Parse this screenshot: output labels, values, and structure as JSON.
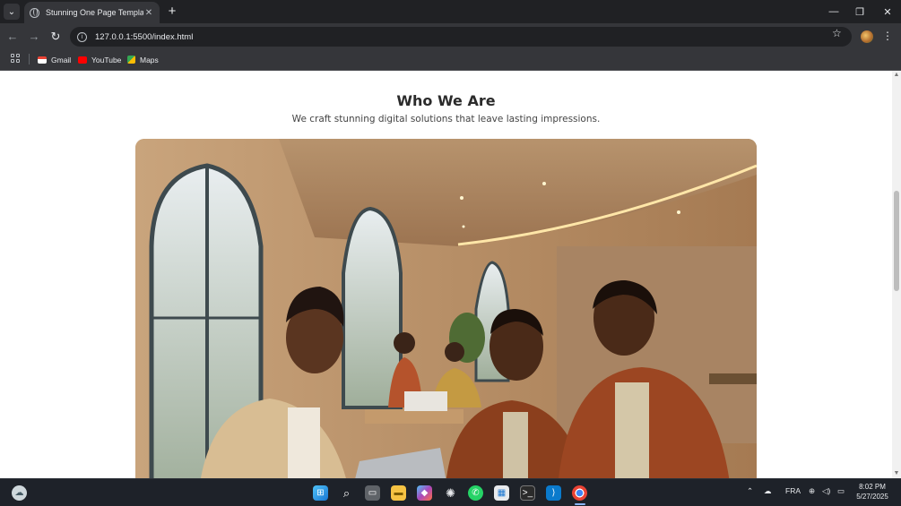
{
  "browser": {
    "tab_title": "Stunning One Page Template",
    "url": "127.0.0.1:5500/index.html",
    "bookmarks": [
      {
        "label": "Gmail",
        "icon": "gmail-icon",
        "color": "#ea4335"
      },
      {
        "label": "YouTube",
        "icon": "youtube-icon",
        "color": "#ff0000"
      },
      {
        "label": "Maps",
        "icon": "maps-icon",
        "color": "#34a853"
      }
    ]
  },
  "page": {
    "section_title": "Who We Are",
    "section_subtitle": "We craft stunning digital solutions that leave lasting impressions.",
    "hero_image": "team-meeting-photo"
  },
  "taskbar": {
    "language": "FRA",
    "time": "8:02 PM",
    "date": "5/27/2025"
  }
}
